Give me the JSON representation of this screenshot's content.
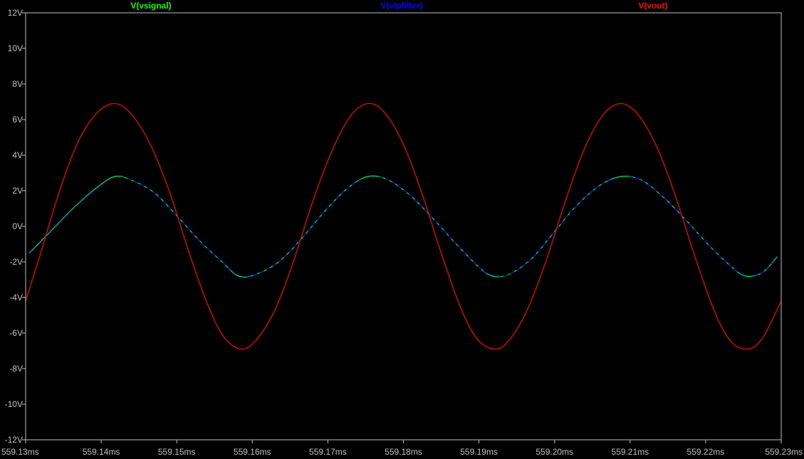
{
  "chart_data": {
    "type": "line",
    "title": "",
    "xlabel": "",
    "ylabel": "",
    "xlim": [
      559.13,
      559.23
    ],
    "ylim": [
      -12,
      12
    ],
    "grid": false,
    "legend_position": "top",
    "x_ticks": [
      559.13,
      559.14,
      559.15,
      559.16,
      559.17,
      559.18,
      559.19,
      559.2,
      559.21,
      559.22,
      559.23
    ],
    "x_tick_labels": [
      "559.13ms",
      "559.14ms",
      "559.15ms",
      "559.16ms",
      "559.17ms",
      "559.18ms",
      "559.19ms",
      "559.20ms",
      "559.21ms",
      "559.22ms",
      "559.23ms"
    ],
    "y_ticks": [
      12,
      10,
      8,
      6,
      4,
      2,
      0,
      -2,
      -4,
      -6,
      -8,
      -10,
      -12
    ],
    "y_tick_labels": [
      "12V",
      "10V",
      "8V",
      "6V",
      "4V",
      "2V",
      "0V",
      "-2V",
      "-4V",
      "-6V",
      "-8V",
      "-10V",
      "-12V"
    ],
    "series": [
      {
        "name": "V(vsignal)",
        "color": "#00ff00",
        "x": [
          559.1305,
          559.1335,
          559.1365,
          559.1395,
          559.1418,
          559.144,
          559.147,
          559.15,
          559.153,
          559.156,
          559.1582,
          559.1605,
          559.1635,
          559.1665,
          559.1695,
          559.1725,
          559.1753,
          559.178,
          559.181,
          559.184,
          559.187,
          559.19,
          559.1918,
          559.194,
          559.197,
          559.2,
          559.203,
          559.206,
          559.2088,
          559.2115,
          559.2145,
          559.2175,
          559.2205,
          559.2235,
          559.2253,
          559.2275,
          559.2295
        ],
        "y": [
          -1.5,
          -0.2,
          1.1,
          2.2,
          2.8,
          2.6,
          1.9,
          0.6,
          -0.8,
          -2.0,
          -2.8,
          -2.7,
          -2.0,
          -0.7,
          0.8,
          2.1,
          2.8,
          2.6,
          1.7,
          0.4,
          -1.0,
          -2.3,
          -2.8,
          -2.7,
          -1.8,
          -0.3,
          1.2,
          2.3,
          2.8,
          2.6,
          1.6,
          0.3,
          -1.1,
          -2.3,
          -2.8,
          -2.6,
          -1.7
        ]
      },
      {
        "name": "V(vlpfilter)",
        "color": "#0000ff",
        "x": [
          559.1305,
          559.1335,
          559.1365,
          559.1395,
          559.1418,
          559.144,
          559.147,
          559.15,
          559.153,
          559.156,
          559.1582,
          559.1605,
          559.1635,
          559.1665,
          559.1695,
          559.1725,
          559.1753,
          559.178,
          559.181,
          559.184,
          559.187,
          559.19,
          559.1918,
          559.194,
          559.197,
          559.2,
          559.203,
          559.206,
          559.2088,
          559.2115,
          559.2145,
          559.2175,
          559.2205,
          559.2235,
          559.2253,
          559.2275,
          559.2295
        ],
        "y": [
          -1.55,
          -0.25,
          1.05,
          2.15,
          2.75,
          2.6,
          1.9,
          0.6,
          -0.8,
          -2.0,
          -2.75,
          -2.7,
          -2.0,
          -0.7,
          0.8,
          2.1,
          2.75,
          2.6,
          1.7,
          0.4,
          -1.0,
          -2.3,
          -2.75,
          -2.7,
          -1.8,
          -0.3,
          1.2,
          2.3,
          2.75,
          2.6,
          1.6,
          0.3,
          -1.1,
          -2.3,
          -2.75,
          -2.6,
          -1.75
        ]
      },
      {
        "name": "V(vout)",
        "color": "#ff0000",
        "x": [
          559.13,
          559.132,
          559.1345,
          559.137,
          559.1395,
          559.1418,
          559.144,
          559.1465,
          559.149,
          559.1515,
          559.154,
          559.1562,
          559.1585,
          559.1605,
          559.163,
          559.1655,
          559.168,
          559.1705,
          559.173,
          559.1753,
          559.1775,
          559.18,
          559.1825,
          559.185,
          559.1875,
          559.1897,
          559.192,
          559.194,
          559.1965,
          559.199,
          559.2015,
          559.204,
          559.2065,
          559.2088,
          559.211,
          559.2135,
          559.216,
          559.2185,
          559.221,
          559.2232,
          559.2255,
          559.2275,
          559.23
        ],
        "y": [
          -4.2,
          -1.5,
          2.0,
          4.8,
          6.4,
          6.9,
          6.3,
          4.6,
          2.0,
          -1.3,
          -4.3,
          -6.2,
          -6.9,
          -6.4,
          -4.7,
          -1.9,
          1.4,
          4.2,
          6.2,
          6.9,
          6.4,
          4.6,
          1.8,
          -1.5,
          -4.5,
          -6.3,
          -6.9,
          -6.4,
          -4.6,
          -1.8,
          1.5,
          4.4,
          6.3,
          6.9,
          6.3,
          4.5,
          1.7,
          -1.6,
          -4.6,
          -6.4,
          -6.9,
          -6.3,
          -4.2
        ]
      }
    ]
  },
  "colors": {
    "background": "#000000",
    "axis": "#c0c0c0"
  }
}
